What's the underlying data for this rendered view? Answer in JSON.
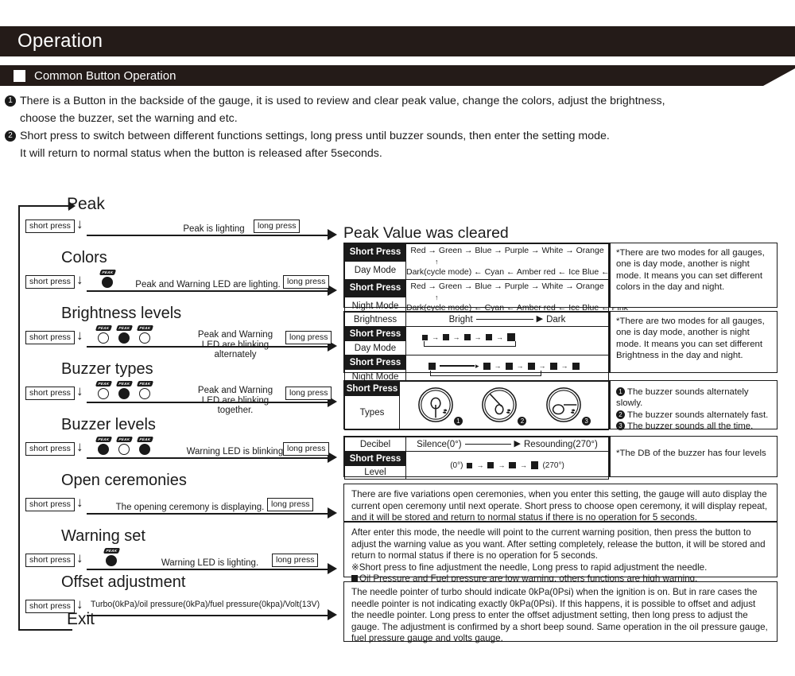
{
  "header": {
    "title": "Operation",
    "subtitle": "Common Button Operation"
  },
  "intro": [
    {
      "num": "❶",
      "line1": "There is a Button in the backside of the gauge, it is used to review and clear peak value, change the colors, adjust the brightness,",
      "line2": "choose the buzzer, set the warning and etc."
    },
    {
      "num": "❷",
      "line1": "Short press to switch between different functions settings,  long press until buzzer sounds, then enter the setting mode.",
      "line2": "It will return to normal status when the button is released after 5seconds."
    }
  ],
  "flow": {
    "entry_label": "Peak",
    "exit_label": "Exit",
    "short_press": "short press",
    "long_press": "long press",
    "rows": [
      {
        "stage": "Peak",
        "desc": "Peak is lighting",
        "leds": []
      },
      {
        "stage": "Colors",
        "desc": "Peak and Warning LED are lighting.",
        "leds": [
          "on"
        ]
      },
      {
        "stage": "Brightness levels",
        "desc": "Peak and Warning\nLED are blinking alternately",
        "leds": [
          "off",
          "on",
          "off"
        ]
      },
      {
        "stage": "Buzzer types",
        "desc": "Peak and Warning\nLED are blinking together.",
        "leds": [
          "off",
          "on",
          "off"
        ]
      },
      {
        "stage": "Buzzer levels",
        "desc": "Warning LED is blinking.",
        "leds": [
          "on",
          "off",
          "on"
        ]
      },
      {
        "stage": "Open ceremonies",
        "desc": "The opening ceremony is displaying.",
        "leds": []
      },
      {
        "stage": "Warning set",
        "desc": "Warning LED is lighting.",
        "leds": [
          "on"
        ]
      },
      {
        "stage": "Offset adjustment",
        "desc": "Turbo(0kPa)/oil pressure(0kPa)/fuel pressure(0kpa)/Volt(13V)",
        "leds": []
      }
    ],
    "led_badge_text": "PEAK"
  },
  "right": {
    "peak_cleared_title": "Peak Value was cleared",
    "colors_panel": {
      "rows": [
        {
          "head_top": "Short Press",
          "head_bottom": "Day Mode",
          "seq_top": "Red  →  Green → Blue → Purple → White → Orange",
          "seq_bottom": "Dark(cycle mode) ← Cyan ← Amber red ← Ice Blue ← Pink"
        },
        {
          "head_top": "Short Press",
          "head_bottom": "Night Mode",
          "seq_top": "Red  →  Green → Blue → Purple → White → Orange",
          "seq_bottom": "Dark(cycle mode) ← Cyan ← Amber red ← Ice Blue ← Pink"
        }
      ],
      "note": "*There are two modes for all gauges, one is day mode, another is night mode. It means you can set different colors in the day and night."
    },
    "brightness_panel": {
      "header_left": "Brightness",
      "header_bright": "Bright",
      "header_dark": "Dark",
      "rows": [
        {
          "head_top": "Short Press",
          "head_bottom": "Day Mode",
          "steps": 5
        },
        {
          "head_top": "Short Press",
          "head_bottom": "Night Mode",
          "steps": 6
        }
      ],
      "note": "*There are two modes for all gauges, one is day mode, another is night mode. It means you can set different Brightness in the day and night."
    },
    "buzzer_types_panel": {
      "head_top": "Short Press",
      "head_bottom": "Types",
      "gauges": [
        {
          "num": "❶",
          "needle": "up"
        },
        {
          "num": "❷",
          "needle": "upleft"
        },
        {
          "num": "❸",
          "needle": "right"
        }
      ],
      "notes": [
        {
          "num": "❶",
          "text": "The buzzer sounds alternately slowly."
        },
        {
          "num": "❷",
          "text": "The buzzer sounds alternately fast."
        },
        {
          "num": "❸",
          "text": "The buzzer sounds all the time."
        }
      ]
    },
    "decibel_panel": {
      "header_left": "Decibel",
      "header_silence": "Silence(0°)",
      "header_resounding": "Resounding(270°)",
      "head_top": "Short Press",
      "head_bottom": "Level",
      "level_prefix": "(0°)",
      "level_suffix": "(270°)",
      "level_steps": 4,
      "note": "*The DB of the buzzer has four levels"
    },
    "open_ceremonies_box": "There are five variations open ceremonies, when you enter this setting, the gauge will auto display the current open ceremony until next operate. Short press to choose open ceremony, it will display repeat, and it will be stored and return to normal status if there is no operation for 5 seconds.",
    "warning_set_box": {
      "p1": "After enter this mode, the needle will point to the current warning position, then press the button to adjust the warning value as you want. After setting completely, release the button, it will be stored and return to normal status if there is no operation for 5 seconds.",
      "p2": "※Short press to fine adjustment the needle, Long press to rapid adjustment the needle.",
      "p3": "Oil Pressure and Fuel pressure are low warning, others functions are high warning."
    },
    "offset_box": "The needle pointer of turbo should indicate 0kPa(0Psi) when the ignition is on. But in rare cases the needle pointer is not indicating exactly 0kPa(0Psi). If this happens,  it is possible to offset and adjust the needle pointer. Long press to enter the offset adjustment setting, then long press to adjust the gauge. The adjustment is confirmed by a short beep sound. Same operation in the oil pressure gauge, fuel pressure gauge and volts gauge."
  },
  "colors": {
    "ink": "#1a1a1a",
    "header_bg": "#241b18",
    "page_bg": "#ffffff"
  }
}
